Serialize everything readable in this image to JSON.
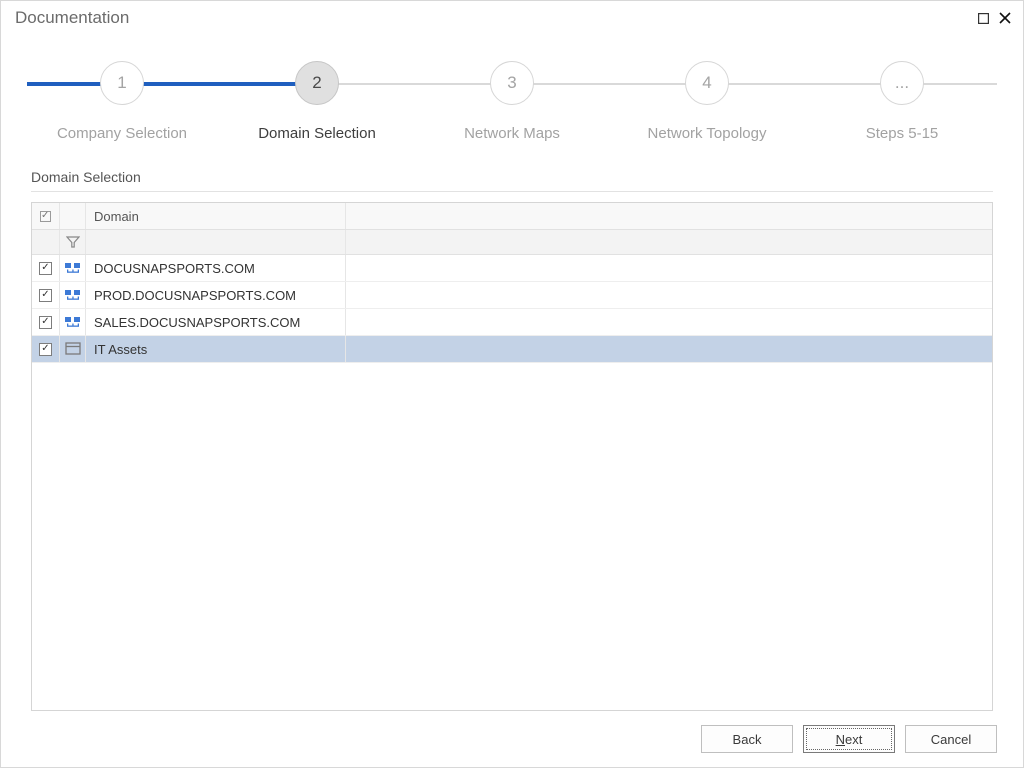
{
  "window": {
    "title": "Documentation"
  },
  "stepper": {
    "steps": [
      {
        "num": "1",
        "label": "Company Selection"
      },
      {
        "num": "2",
        "label": "Domain Selection"
      },
      {
        "num": "3",
        "label": "Network Maps"
      },
      {
        "num": "4",
        "label": "Network Topology"
      },
      {
        "num": "...",
        "label": "Steps 5-15"
      }
    ],
    "active_index": 1
  },
  "section": {
    "title": "Domain Selection"
  },
  "grid": {
    "header": {
      "domain_label": "Domain"
    },
    "rows": [
      {
        "checked": true,
        "icon": "domain",
        "name": "DOCUSNAPSPORTS.COM",
        "selected": false
      },
      {
        "checked": true,
        "icon": "domain",
        "name": "PROD.DOCUSNAPSPORTS.COM",
        "selected": false
      },
      {
        "checked": true,
        "icon": "domain",
        "name": "SALES.DOCUSNAPSPORTS.COM",
        "selected": false
      },
      {
        "checked": true,
        "icon": "assets",
        "name": "IT Assets",
        "selected": true
      }
    ]
  },
  "footer": {
    "back": "Back",
    "next_prefix": "N",
    "next_rest": "ext",
    "cancel": "Cancel"
  }
}
